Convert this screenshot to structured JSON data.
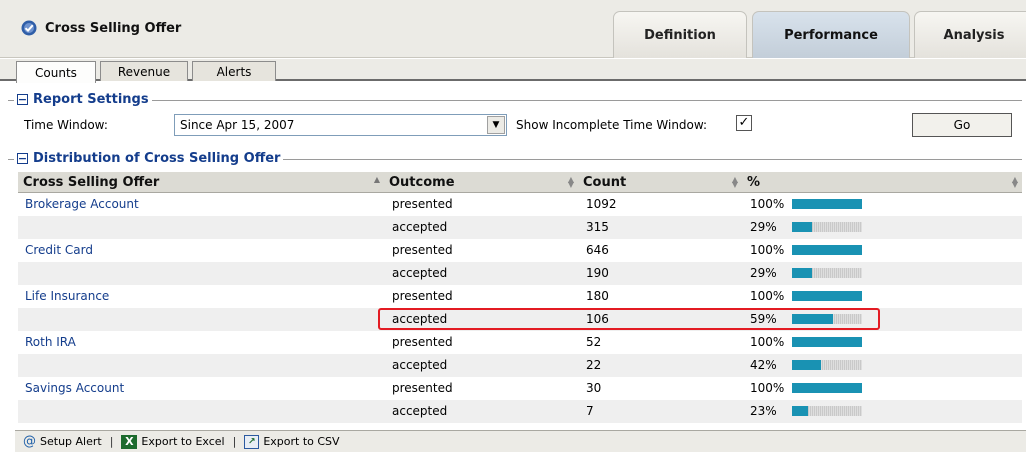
{
  "header": {
    "title": "Cross Selling Offer",
    "tabs": [
      {
        "label": "Definition",
        "active": false
      },
      {
        "label": "Performance",
        "active": true
      },
      {
        "label": "Analysis",
        "active": false
      }
    ]
  },
  "subtabs": [
    {
      "label": "Counts",
      "active": true
    },
    {
      "label": "Revenue",
      "active": false
    },
    {
      "label": "Alerts",
      "active": false
    }
  ],
  "report_settings": {
    "title": "Report Settings",
    "time_window_label": "Time Window:",
    "time_window_value": "Since Apr 15, 2007",
    "incomplete_label": "Show Incomplete Time Window:",
    "incomplete_checked": true,
    "go_label": "Go"
  },
  "distribution": {
    "title": "Distribution of Cross Selling Offer",
    "columns": [
      "Cross Selling Offer",
      "Outcome",
      "Count",
      "%"
    ],
    "rows": [
      {
        "offer": "Brokerage Account",
        "outcome": "presented",
        "count": "1092",
        "pct": "100%",
        "fraction": 1.0
      },
      {
        "offer": "",
        "outcome": "accepted",
        "count": "315",
        "pct": "29%",
        "fraction": 0.29
      },
      {
        "offer": "Credit Card",
        "outcome": "presented",
        "count": "646",
        "pct": "100%",
        "fraction": 1.0
      },
      {
        "offer": "",
        "outcome": "accepted",
        "count": "190",
        "pct": "29%",
        "fraction": 0.29
      },
      {
        "offer": "Life Insurance",
        "outcome": "presented",
        "count": "180",
        "pct": "100%",
        "fraction": 1.0
      },
      {
        "offer": "",
        "outcome": "accepted",
        "count": "106",
        "pct": "59%",
        "fraction": 0.59
      },
      {
        "offer": "Roth IRA",
        "outcome": "presented",
        "count": "52",
        "pct": "100%",
        "fraction": 1.0
      },
      {
        "offer": "",
        "outcome": "accepted",
        "count": "22",
        "pct": "42%",
        "fraction": 0.42
      },
      {
        "offer": "Savings Account",
        "outcome": "presented",
        "count": "30",
        "pct": "100%",
        "fraction": 1.0
      },
      {
        "offer": "",
        "outcome": "accepted",
        "count": "7",
        "pct": "23%",
        "fraction": 0.23
      }
    ],
    "highlighted_row": 5
  },
  "footer": {
    "setup_alert": "Setup Alert",
    "export_excel": "Export to Excel",
    "export_csv": "Export to CSV",
    "separator": "|"
  },
  "colors": {
    "bar": "#1992b3",
    "link": "#143d8c",
    "highlight": "#e31b23"
  }
}
